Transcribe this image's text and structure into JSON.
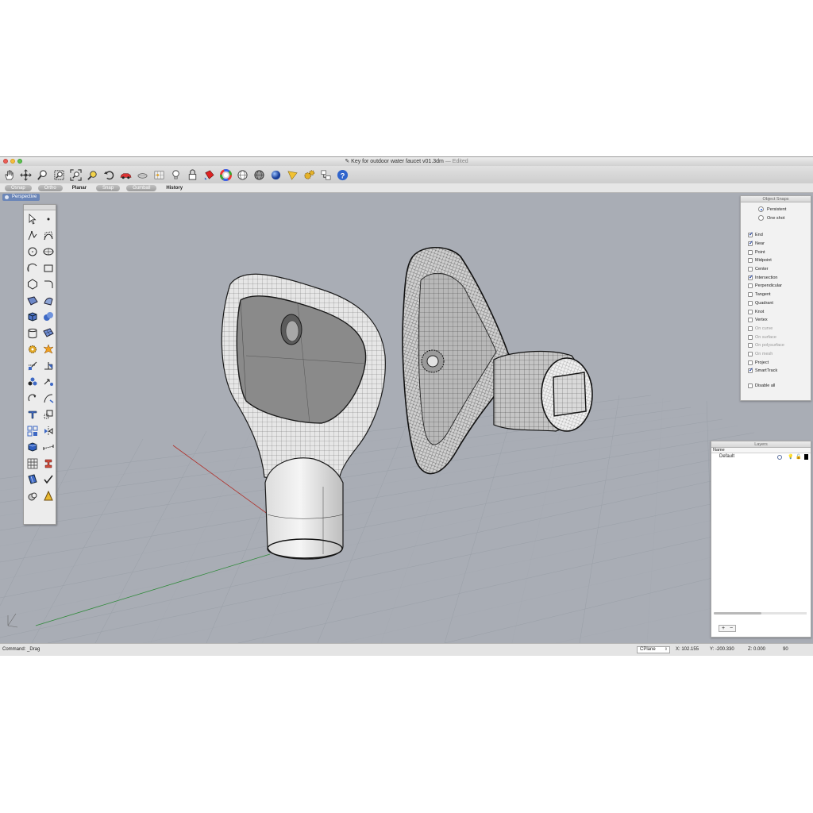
{
  "window": {
    "title": "Key for outdoor water faucet v01.3dm",
    "edited_suffix": "— Edited"
  },
  "toolbar": {
    "icons": [
      "hand-pan-icon",
      "rotate-view-icon",
      "zoom-icon",
      "zoom-window-icon",
      "zoom-extents-icon",
      "zoom-selected-icon",
      "undo-view-icon",
      "car-render-icon",
      "capsule-icon",
      "snap-grid-icon",
      "light-bulb-icon",
      "lock-icon",
      "paint-bucket-icon",
      "color-wheel-icon",
      "sphere-wire-icon",
      "sphere-shaded-icon",
      "sphere-render-icon",
      "flag-icon",
      "gears-icon",
      "filter-icon",
      "help-icon"
    ]
  },
  "modes": {
    "osnap": "Osnap",
    "ortho": "Ortho",
    "planar": "Planar",
    "snap": "Snap",
    "gumball": "Gumball",
    "history": "History"
  },
  "viewport": {
    "name": "Perspective",
    "background": "#a9adb5"
  },
  "object_snaps": {
    "title": "Object Snaps",
    "mode_persistent": "Persistent",
    "mode_one_shot": "One shot",
    "selected_mode": "Persistent",
    "items": [
      {
        "label": "End",
        "checked": true,
        "enabled": true
      },
      {
        "label": "Near",
        "checked": true,
        "enabled": true
      },
      {
        "label": "Point",
        "checked": false,
        "enabled": true
      },
      {
        "label": "Midpoint",
        "checked": false,
        "enabled": true
      },
      {
        "label": "Center",
        "checked": false,
        "enabled": true
      },
      {
        "label": "Intersection",
        "checked": true,
        "enabled": true
      },
      {
        "label": "Perpendicular",
        "checked": false,
        "enabled": true
      },
      {
        "label": "Tangent",
        "checked": false,
        "enabled": true
      },
      {
        "label": "Quadrant",
        "checked": false,
        "enabled": true
      },
      {
        "label": "Knot",
        "checked": false,
        "enabled": true
      },
      {
        "label": "Vertex",
        "checked": false,
        "enabled": true
      },
      {
        "label": "On curve",
        "checked": false,
        "enabled": false
      },
      {
        "label": "On surface",
        "checked": false,
        "enabled": false
      },
      {
        "label": "On polysurface",
        "checked": false,
        "enabled": false
      },
      {
        "label": "On mesh",
        "checked": false,
        "enabled": false
      },
      {
        "label": "Project",
        "checked": false,
        "enabled": true
      },
      {
        "label": "SmartTrack",
        "checked": true,
        "enabled": true
      }
    ],
    "disable_all": "Disable all"
  },
  "layers": {
    "title": "Layers",
    "column_name": "Name",
    "rows": [
      {
        "name": "Default",
        "color": "#000000"
      }
    ],
    "add_label": "+",
    "remove_label": "−"
  },
  "status": {
    "command": "Command: _Drag",
    "cplane": "CPlane",
    "x": "X: 102.155",
    "y": "Y: -200.330",
    "z": "Z: 0.000",
    "value": "90"
  }
}
